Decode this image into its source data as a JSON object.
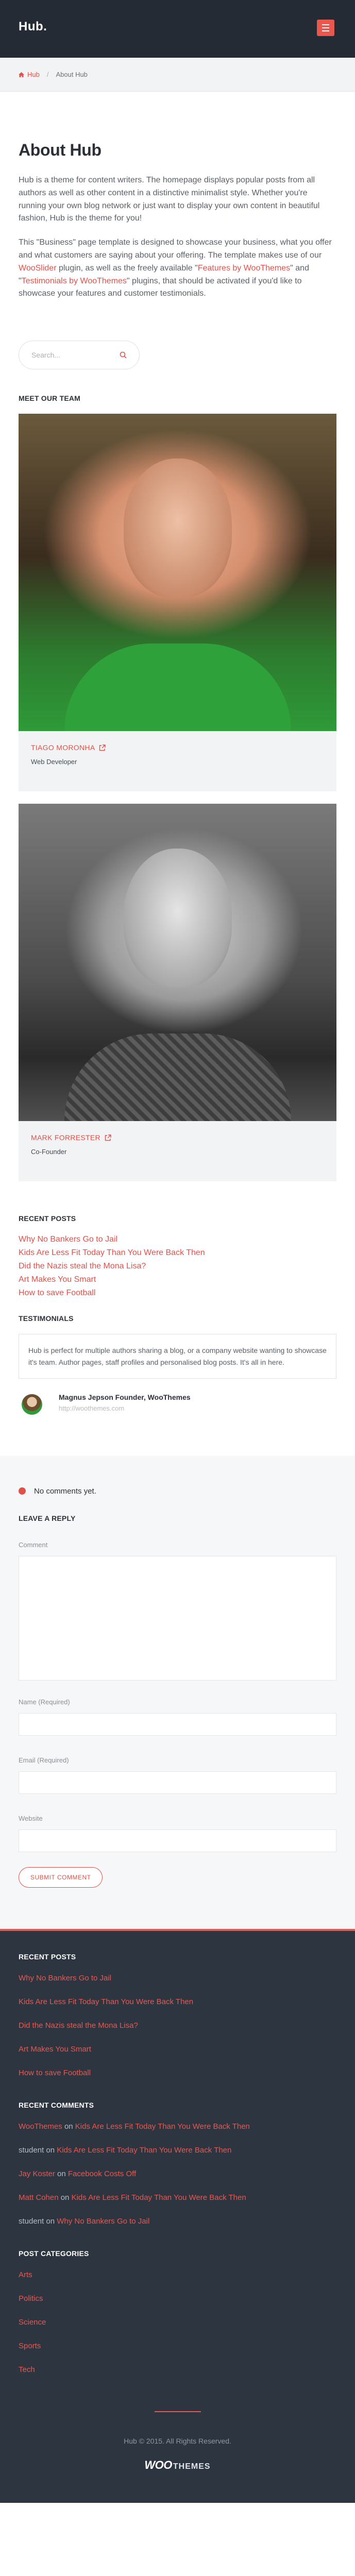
{
  "header": {
    "logo": "Hub."
  },
  "breadcrumb": {
    "home": "Hub",
    "separator": "/",
    "current": "About Hub"
  },
  "page": {
    "title": "About Hub",
    "para1": "Hub is a theme for content writers. The homepage displays popular posts from all authors as well as other content in a distinctive minimalist style. Whether you're running your own blog network or just want to display your own content in beautiful fashion, Hub is the theme for you!",
    "para2_pre": "This \"Business\" page template is designed to showcase your business, what you offer and what customers are saying about your offering. The template makes use of our ",
    "para2_link1": "WooSlider",
    "para2_mid1": " plugin, as well as the freely available \"",
    "para2_link2": "Features by WooThemes",
    "para2_mid2": "\" and \"",
    "para2_link3": "Testimonials by WooThemes",
    "para2_post": "\" plugins, that should be activated if you'd like to showcase your features and customer testimonials."
  },
  "search": {
    "placeholder": "Search..."
  },
  "team": {
    "heading": "MEET OUR TEAM",
    "members": [
      {
        "name": "TIAGO MORONHA",
        "role": "Web Developer"
      },
      {
        "name": "MARK FORRESTER",
        "role": "Co-Founder"
      }
    ]
  },
  "recent_posts": {
    "heading": "RECENT POSTS",
    "items": [
      "Why No Bankers Go to Jail",
      "Kids Are Less Fit Today Than You Were Back Then",
      "Did the Nazis steal the Mona Lisa?",
      "Art Makes You Smart",
      "How to save Football"
    ]
  },
  "testimonials": {
    "heading": "TESTIMONIALS",
    "quote": "Hub is perfect for multiple authors sharing a blog, or a company website wanting to showcase it's team. Author pages, staff profiles and personalised blog posts. It's all in here.",
    "author": "Magnus Jepson Founder, WooThemes",
    "url": "http://woothemes.com"
  },
  "comments": {
    "no_comments": "No comments yet.",
    "leave_reply": "LEAVE A REPLY",
    "comment_label": "Comment",
    "name_label": "Name (Required)",
    "email_label": "Email (Required)",
    "website_label": "Website",
    "submit": "SUBMIT COMMENT"
  },
  "footer": {
    "recent_posts_heading": "RECENT POSTS",
    "recent_posts": [
      "Why No Bankers Go to Jail",
      "Kids Are Less Fit Today Than You Were Back Then",
      "Did the Nazis steal the Mona Lisa?",
      "Art Makes You Smart",
      "How to save Football"
    ],
    "recent_comments_heading": "RECENT COMMENTS",
    "recent_comments": [
      {
        "author": "WooThemes",
        "on": "on",
        "post": "Kids Are Less Fit Today Than You Were Back Then",
        "author_link": true
      },
      {
        "author": "student",
        "on": "on",
        "post": "Kids Are Less Fit Today Than You Were Back Then",
        "author_link": false
      },
      {
        "author": "Jay Koster",
        "on": "on",
        "post": "Facebook Costs Off",
        "author_link": true
      },
      {
        "author": "Matt Cohen",
        "on": "on",
        "post": "Kids Are Less Fit Today Than You Were Back Then",
        "author_link": true
      },
      {
        "author": "student",
        "on": "on",
        "post": "Why No Bankers Go to Jail",
        "author_link": false
      }
    ],
    "categories_heading": "POST CATEGORIES",
    "categories": [
      "Arts",
      "Politics",
      "Science",
      "Sports",
      "Tech"
    ],
    "copyright": "Hub © 2015. All Rights Reserved.",
    "brand_main": "WOO",
    "brand_sub": "THEMES"
  },
  "colors": {
    "accent": "#e8584f",
    "header_bg": "#252b34",
    "footer_bg": "#2d3541"
  }
}
